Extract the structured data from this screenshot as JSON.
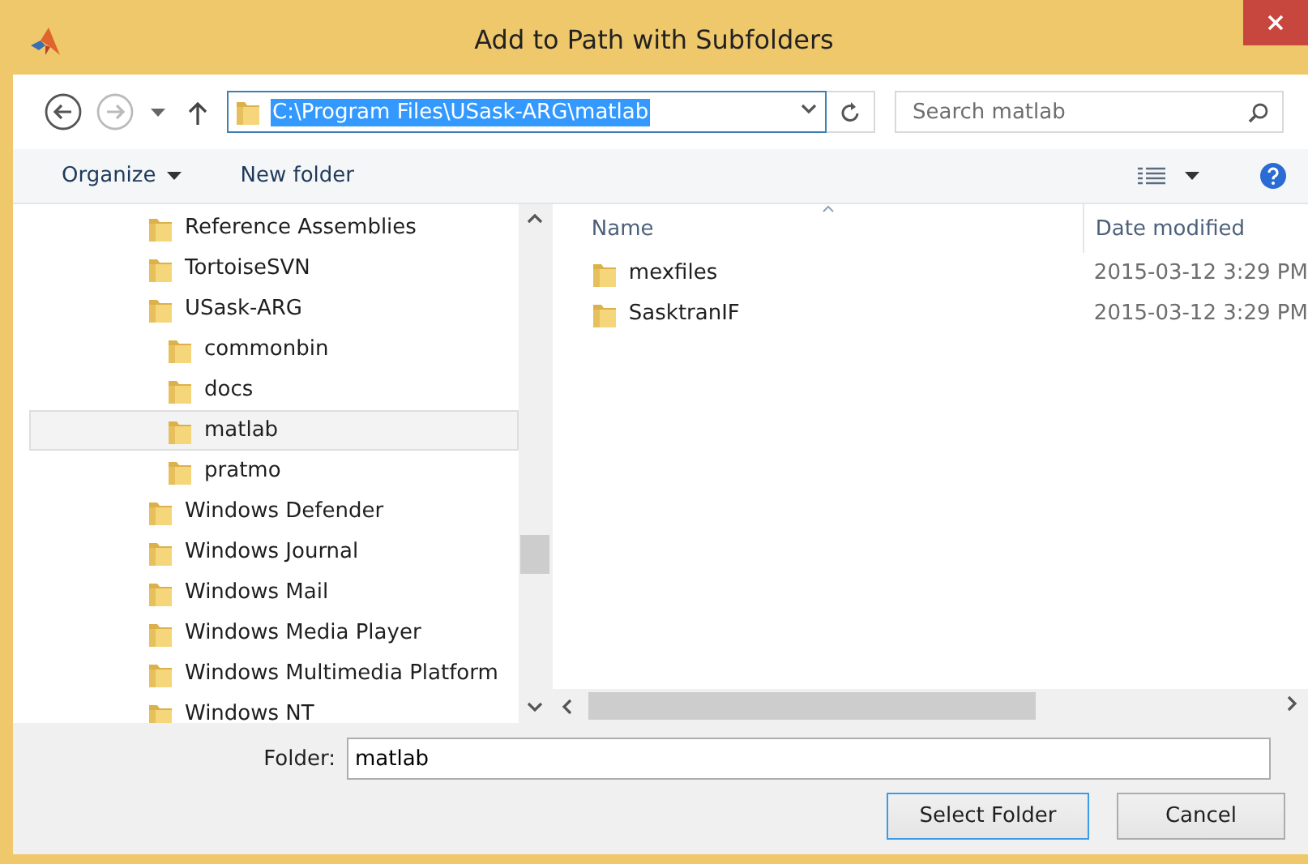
{
  "window": {
    "title": "Add to Path with Subfolders"
  },
  "address": {
    "path": "C:\\Program Files\\USask-ARG\\matlab"
  },
  "search": {
    "placeholder": "Search matlab"
  },
  "toolbar": {
    "organize": "Organize",
    "new_folder": "New folder"
  },
  "tree": [
    {
      "label": "Reference Assemblies",
      "selected": false
    },
    {
      "label": "TortoiseSVN",
      "selected": false
    },
    {
      "label": "USask-ARG",
      "selected": false,
      "children": [
        {
          "label": "commonbin",
          "selected": false
        },
        {
          "label": "docs",
          "selected": false
        },
        {
          "label": "matlab",
          "selected": true
        },
        {
          "label": "pratmo",
          "selected": false
        }
      ]
    },
    {
      "label": "Windows Defender",
      "selected": false
    },
    {
      "label": "Windows Journal",
      "selected": false
    },
    {
      "label": "Windows Mail",
      "selected": false
    },
    {
      "label": "Windows Media Player",
      "selected": false
    },
    {
      "label": "Windows Multimedia Platform",
      "selected": false
    },
    {
      "label": "Windows NT",
      "selected": false
    }
  ],
  "columns": [
    "Name",
    "Date modified"
  ],
  "files": [
    {
      "name": "mexfiles",
      "date": "2015-03-12 3:29 PM"
    },
    {
      "name": "SasktranIF",
      "date": "2015-03-12 3:29 PM"
    }
  ],
  "folder": {
    "label": "Folder:",
    "value": "matlab"
  },
  "buttons": [
    {
      "label": "Select Folder",
      "default": true
    },
    {
      "label": "Cancel",
      "default": false
    }
  ]
}
